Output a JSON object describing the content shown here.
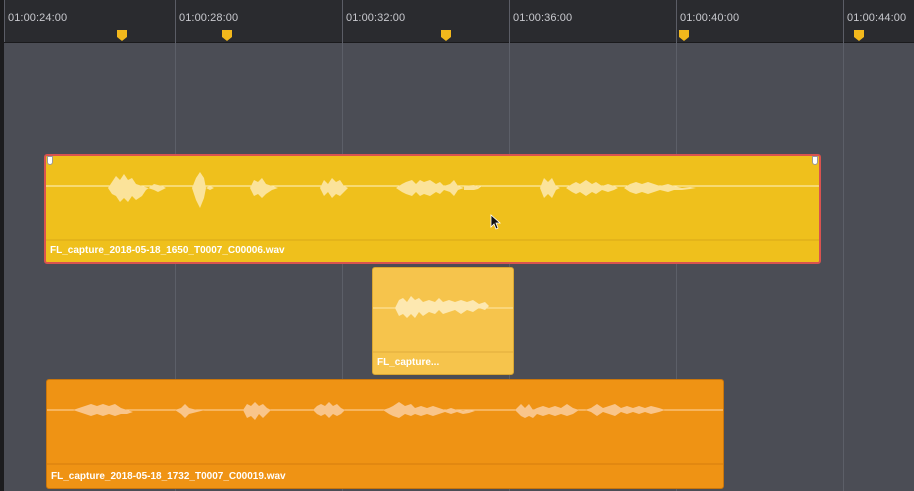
{
  "ruler": {
    "timecodes": [
      "01:00:24:00",
      "01:00:28:00",
      "01:00:32:00",
      "01:00:36:00",
      "01:00:40:00",
      "01:00:44:00"
    ]
  },
  "colors": {
    "track_bg": "#4b4d55",
    "ruler_bg": "#2a2b2f",
    "marker": "#f2b81c",
    "clip_yellow": "#efc01c",
    "clip_light": "#f6c44c",
    "clip_orange": "#ef9314",
    "selection_outline": "#d9534f"
  },
  "clips": {
    "clip1": {
      "name": "FL_capture_2018-05-18_1650_T0007_C00006.wav",
      "selected": true
    },
    "clip2": {
      "name": "FL_capture..."
    },
    "clip3": {
      "name": "FL_capture_2018-05-18_1732_T0007_C00019.wav"
    }
  },
  "icons": {
    "marker": "marker-icon",
    "cursor": "mouse-pointer-icon",
    "trim_handle": "trim-handle-icon"
  }
}
